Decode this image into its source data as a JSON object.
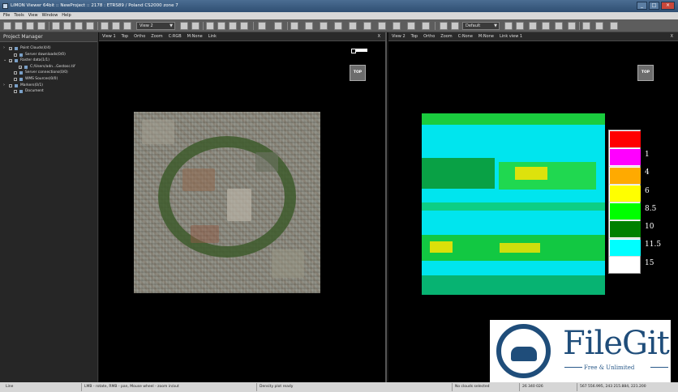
{
  "window": {
    "title": "LiMON Viewer 64bit :: NewProject :: 2178 : ETRS89 / Poland CS2000 zone 7",
    "buttons": [
      "_",
      "□",
      "×"
    ]
  },
  "menu": [
    "File",
    "Tools",
    "View",
    "Window",
    "Help"
  ],
  "toolbar": {
    "view_combo": "View 2",
    "default_combo": "Default"
  },
  "project_manager": {
    "title": "Project Manager",
    "items": [
      {
        "label": "Point Clouds(4/4)",
        "level": 0,
        "expander": "›",
        "checked": true
      },
      {
        "label": "Server downloads(0/0)",
        "level": 1,
        "expander": "",
        "checked": false
      },
      {
        "label": "Raster data(1/1)",
        "level": 0,
        "expander": "⌄",
        "checked": true
      },
      {
        "label": "C:/Users/adn...Gestosc.tif",
        "level": 2,
        "expander": "",
        "checked": true
      },
      {
        "label": "Server connections(0/0)",
        "level": 1,
        "expander": "",
        "checked": false
      },
      {
        "label": "WMS Sources(0/0)",
        "level": 1,
        "expander": "",
        "checked": false
      },
      {
        "label": "Markers(0/1)",
        "level": 0,
        "expander": "›",
        "checked": false
      },
      {
        "label": "Document",
        "level": 1,
        "expander": "",
        "checked": false
      }
    ]
  },
  "view1": {
    "tabs": [
      "View 1",
      "Top",
      "Ortho",
      "Zoom",
      "C:RGB",
      "M:None",
      "Link"
    ],
    "close": "X",
    "top_button": "TOP"
  },
  "view2": {
    "tabs": [
      "View 2",
      "Top",
      "Ortho",
      "Zoom",
      "C:None",
      "M:None",
      "Link view 1"
    ],
    "close": "X",
    "top_button": "TOP",
    "legend": [
      {
        "label": "1",
        "color": "#ff0000"
      },
      {
        "label": "4",
        "color": "#ff00ff"
      },
      {
        "label": "6",
        "color": "#ffaa00"
      },
      {
        "label": "8.5",
        "color": "#ffff00"
      },
      {
        "label": "10",
        "color": "#00ff00"
      },
      {
        "label": "11.5",
        "color": "#008000"
      },
      {
        "label": "15",
        "color": "#00ffff"
      }
    ]
  },
  "status": {
    "mode": "Line",
    "hint": "LMB - rotate, RMB - pan, Mouse wheel - zoom in/out",
    "message": "Density plot ready",
    "selection": "No clouds selected",
    "count": "26 340 026",
    "coords": "567 556.995, 243 215.884, 221.200"
  },
  "watermark": {
    "name": "FileGit",
    "tagline": "Free & Unlimited"
  }
}
